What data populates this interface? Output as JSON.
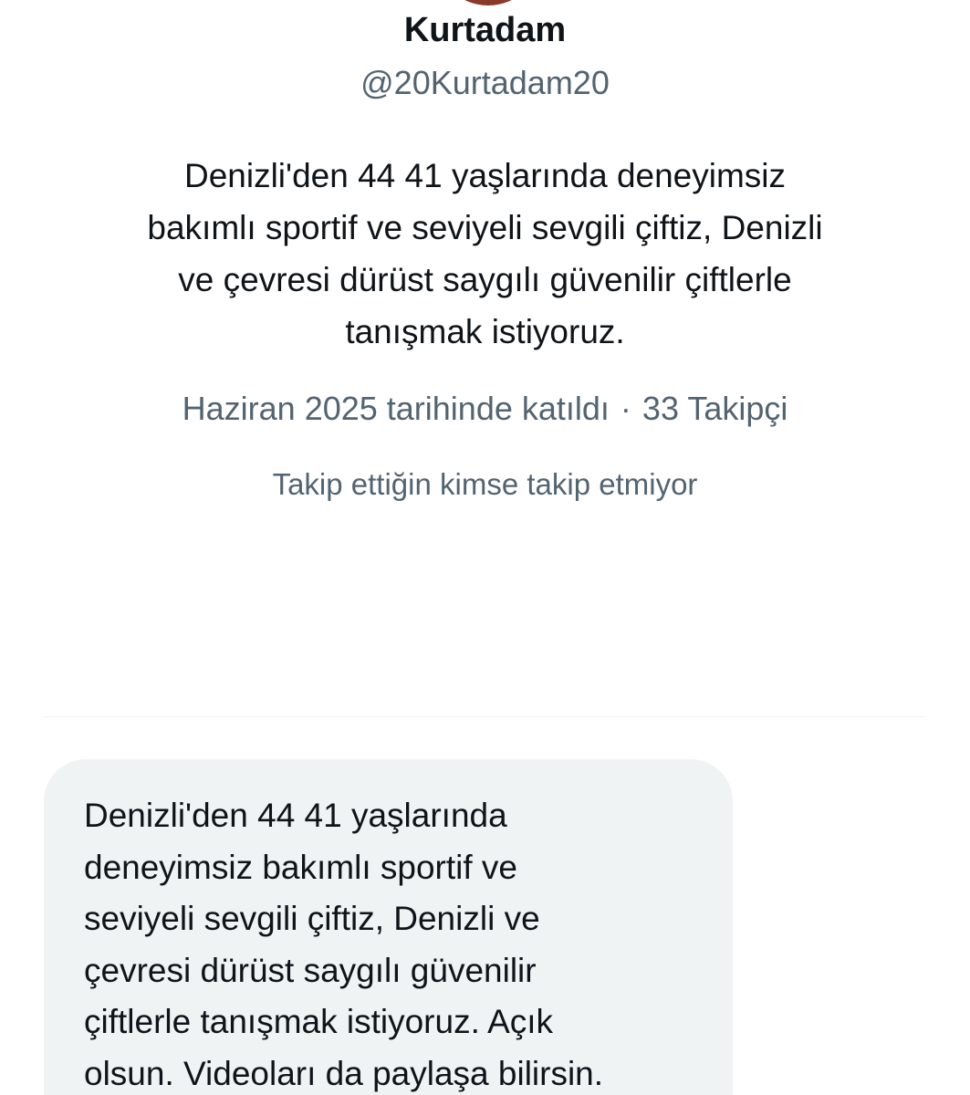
{
  "profile": {
    "display_name": "Kurtadam",
    "handle": "@20Kurtadam20",
    "bio": "Denizli'den 44 41 yaşlarında deneyimsiz\nbakımlı sportif ve seviyeli sevgili çiftiz, Denizli\nve çevresi dürüst saygılı güvenilir çiftlerle\ntanışmak istiyoruz.",
    "joined": "Haziran 2025 tarihinde katıldı",
    "separator": "·",
    "followers": "33 Takipçi",
    "mutual_followers": "Takip ettiğin kimse takip etmiyor"
  },
  "message": {
    "text": "Denizli'den 44 41 yaşlarında\ndeneyimsiz bakımlı sportif ve\nseviyeli sevgili çiftiz, Denizli ve\nçevresi dürüst saygılı güvenilir\nçiftlerle tanışmak istiyoruz. Açık\nolsun. Videoları da paylaşa bilirsin."
  },
  "colors": {
    "primary_text": "#0f1419",
    "secondary_text": "#536471",
    "bubble_bg": "#eff3f4",
    "divider": "#eff3f4",
    "avatar": "#8a3a2b"
  }
}
